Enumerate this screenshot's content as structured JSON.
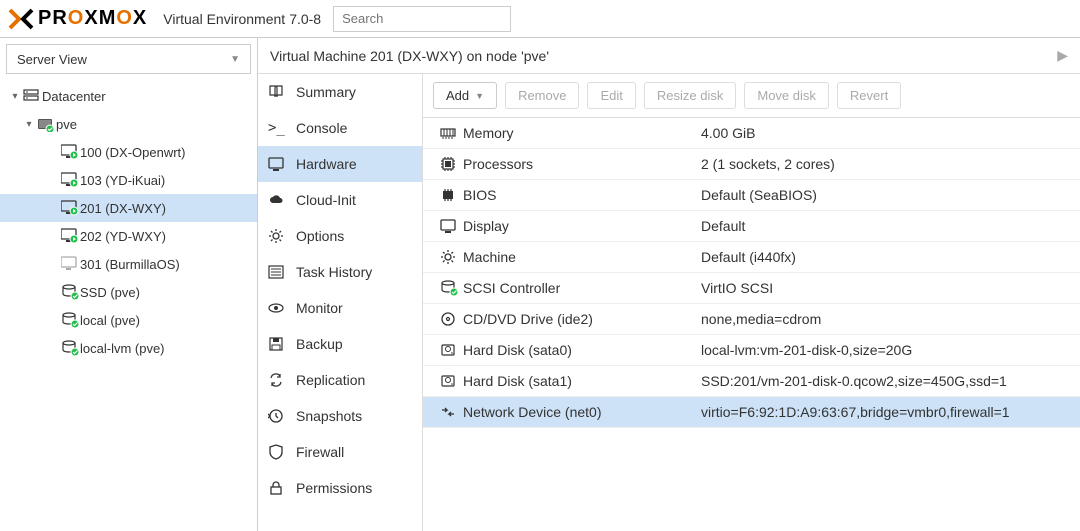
{
  "header": {
    "brand": "PROXMOX",
    "product": "Virtual Environment",
    "version": "7.0-8",
    "search_placeholder": "Search"
  },
  "sidebar": {
    "view_label": "Server View",
    "tree": [
      {
        "label": "Datacenter",
        "icon": "datacenter",
        "depth": 0,
        "exp": "open"
      },
      {
        "label": "pve",
        "icon": "node",
        "depth": 1,
        "exp": "open"
      },
      {
        "label": "100 (DX-Openwrt)",
        "icon": "vm-running",
        "depth": 2
      },
      {
        "label": "103 (YD-iKuai)",
        "icon": "vm-running",
        "depth": 2
      },
      {
        "label": "201 (DX-WXY)",
        "icon": "vm-running",
        "depth": 2,
        "selected": true
      },
      {
        "label": "202 (YD-WXY)",
        "icon": "vm-running",
        "depth": 2
      },
      {
        "label": "301 (BurmillaOS)",
        "icon": "vm-stopped",
        "depth": 2
      },
      {
        "label": "SSD (pve)",
        "icon": "storage",
        "depth": 2
      },
      {
        "label": "local (pve)",
        "icon": "storage",
        "depth": 2
      },
      {
        "label": "local-lvm (pve)",
        "icon": "storage",
        "depth": 2
      }
    ]
  },
  "main": {
    "title": "Virtual Machine 201 (DX-WXY) on node 'pve'",
    "subnav": [
      {
        "label": "Summary",
        "icon": "book"
      },
      {
        "label": "Console",
        "icon": "terminal"
      },
      {
        "label": "Hardware",
        "icon": "monitor",
        "selected": true
      },
      {
        "label": "Cloud-Init",
        "icon": "cloud"
      },
      {
        "label": "Options",
        "icon": "gear"
      },
      {
        "label": "Task History",
        "icon": "list"
      },
      {
        "label": "Monitor",
        "icon": "eye"
      },
      {
        "label": "Backup",
        "icon": "save"
      },
      {
        "label": "Replication",
        "icon": "replication"
      },
      {
        "label": "Snapshots",
        "icon": "history"
      },
      {
        "label": "Firewall",
        "icon": "shield"
      },
      {
        "label": "Permissions",
        "icon": "lock"
      }
    ],
    "toolbar": {
      "add": "Add",
      "remove": "Remove",
      "edit": "Edit",
      "resize": "Resize disk",
      "move": "Move disk",
      "revert": "Revert"
    },
    "hardware_rows": [
      {
        "icon": "memory",
        "key": "Memory",
        "value": "4.00 GiB"
      },
      {
        "icon": "cpu",
        "key": "Processors",
        "value": "2 (1 sockets, 2 cores)"
      },
      {
        "icon": "chip",
        "key": "BIOS",
        "value": "Default (SeaBIOS)"
      },
      {
        "icon": "monitor",
        "key": "Display",
        "value": "Default"
      },
      {
        "icon": "gear",
        "key": "Machine",
        "value": "Default (i440fx)"
      },
      {
        "icon": "storage",
        "key": "SCSI Controller",
        "value": "VirtIO SCSI"
      },
      {
        "icon": "disc",
        "key": "CD/DVD Drive (ide2)",
        "value": "none,media=cdrom"
      },
      {
        "icon": "hdd",
        "key": "Hard Disk (sata0)",
        "value": "local-lvm:vm-201-disk-0,size=20G"
      },
      {
        "icon": "hdd",
        "key": "Hard Disk (sata1)",
        "value": "SSD:201/vm-201-disk-0.qcow2,size=450G,ssd=1"
      },
      {
        "icon": "network",
        "key": "Network Device (net0)",
        "value": "virtio=F6:92:1D:A9:63:67,bridge=vmbr0,firewall=1",
        "selected": true
      }
    ]
  }
}
